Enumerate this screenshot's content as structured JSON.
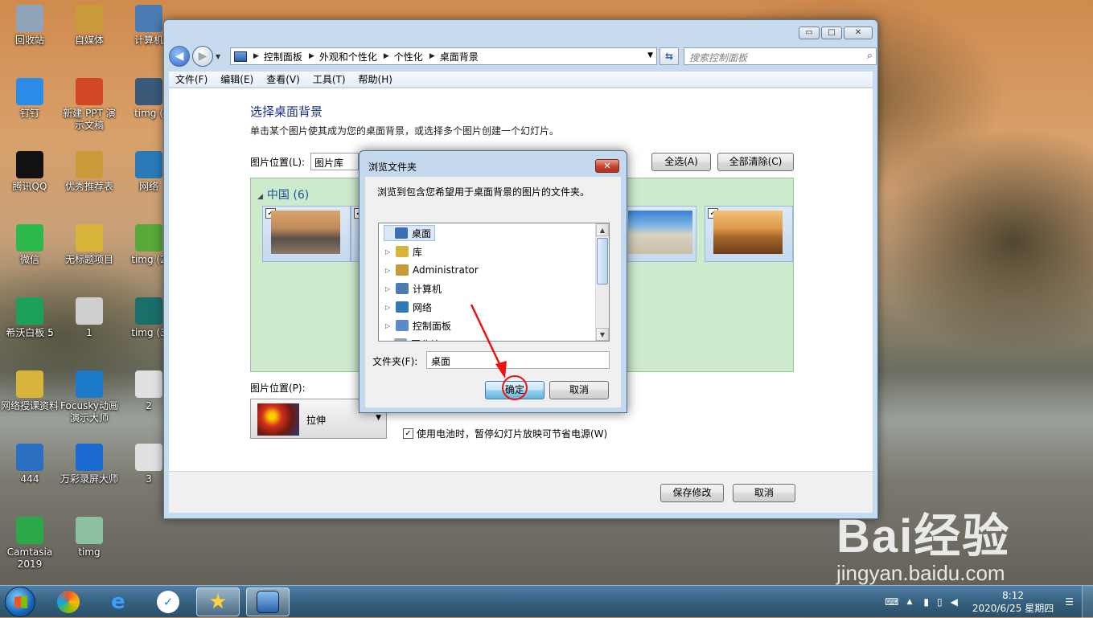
{
  "desktop_icons": [
    {
      "label": "回收站",
      "icon": "recycle-bin-icon",
      "color": "#8fa4b8"
    },
    {
      "label": "自媒体",
      "icon": "folder-icon",
      "color": "#c99a3a"
    },
    {
      "label": "计算机",
      "icon": "computer-icon",
      "color": "#4a7cb3"
    },
    {
      "label": "钉钉",
      "icon": "dingtalk-icon",
      "color": "#2a8ce6"
    },
    {
      "label": "新建 PPT 演示文稿",
      "icon": "ppt-file-icon",
      "color": "#d24726"
    },
    {
      "label": "timg (",
      "icon": "image-file-icon",
      "color": "#3a5a7a"
    },
    {
      "label": "腾讯QQ",
      "icon": "qq-icon",
      "color": "#111111"
    },
    {
      "label": "优秀推荐表",
      "icon": "folder-icon",
      "color": "#c99a3a"
    },
    {
      "label": "网络",
      "icon": "network-icon",
      "color": "#2a7ab8"
    },
    {
      "label": "微信",
      "icon": "wechat-icon",
      "color": "#2db84b"
    },
    {
      "label": "无标题项目",
      "icon": "folder-icon",
      "color": "#d9b43a"
    },
    {
      "label": "timg (2",
      "icon": "image-file-icon",
      "color": "#58a83a"
    },
    {
      "label": "希沃白板 5",
      "icon": "seewo-icon",
      "color": "#1ca05a"
    },
    {
      "label": "1",
      "icon": "image-file-icon",
      "color": "#cfcfcf"
    },
    {
      "label": "timg (3",
      "icon": "image-file-icon",
      "color": "#1a6f6a"
    },
    {
      "label": "网络授课资料",
      "icon": "folder-icon",
      "color": "#d9b43a"
    },
    {
      "label": "Focusky动画演示大师",
      "icon": "focusky-icon",
      "color": "#1b7ac9"
    },
    {
      "label": "2",
      "icon": "image-file-icon",
      "color": "#e0e0e0"
    },
    {
      "label": "444",
      "icon": "fs-file-icon",
      "color": "#2a6fc0"
    },
    {
      "label": "万彩录屏大师",
      "icon": "recorder-icon",
      "color": "#1b6ad0"
    },
    {
      "label": "3",
      "icon": "image-file-icon",
      "color": "#e0e0e0"
    },
    {
      "label": "Camtasia 2019",
      "icon": "camtasia-icon",
      "color": "#2aa84a"
    },
    {
      "label": "timg",
      "icon": "image-file-icon",
      "color": "#8cc0a0"
    }
  ],
  "window": {
    "controls": {
      "minimize": "▭",
      "maximize": "□",
      "close": "✕"
    },
    "breadcrumbs": [
      "控制面板",
      "外观和个性化",
      "个性化",
      "桌面背景"
    ],
    "search_placeholder": "搜索控制面板",
    "menu": [
      "文件(F)",
      "编辑(E)",
      "查看(V)",
      "工具(T)",
      "帮助(H)"
    ],
    "title": "选择桌面背景",
    "description": "单击某个图片使其成为您的桌面背景，或选择多个图片创建一个幻灯片。",
    "location_label": "图片位置(L):",
    "location_value": "图片库",
    "select_all": "全选(A)",
    "clear_all": "全部清除(C)",
    "group_label": "中国 (6)",
    "position_label": "图片位置(P):",
    "position_value": "拉伸",
    "battery_option": "使用电池时，暂停幻灯片放映可节省电源(W)",
    "save_button": "保存修改",
    "cancel_button": "取消"
  },
  "dialog": {
    "title": "浏览文件夹",
    "close": "✕",
    "instruction": "浏览到包含您希望用于桌面背景的图片的文件夹。",
    "tree": [
      {
        "label": "桌面",
        "icon": "desktop-icon",
        "selected": true,
        "expandable": false,
        "color": "#3a6fb0"
      },
      {
        "label": "库",
        "icon": "library-icon",
        "selected": false,
        "expandable": true,
        "color": "#d9b43a"
      },
      {
        "label": "Administrator",
        "icon": "user-folder-icon",
        "selected": false,
        "expandable": true,
        "color": "#c99a3a"
      },
      {
        "label": "计算机",
        "icon": "computer-icon",
        "selected": false,
        "expandable": true,
        "color": "#4a7cb3"
      },
      {
        "label": "网络",
        "icon": "network-icon",
        "selected": false,
        "expandable": true,
        "color": "#2a7ab8"
      },
      {
        "label": "控制面板",
        "icon": "control-panel-icon",
        "selected": false,
        "expandable": true,
        "color": "#5a8ac8"
      },
      {
        "label": "回收站",
        "icon": "recycle-bin-icon",
        "selected": false,
        "expandable": false,
        "color": "#8fa4b8"
      }
    ],
    "folder_label": "文件夹(F):",
    "folder_value": "桌面",
    "ok_button": "确定",
    "cancel_button": "取消"
  },
  "taskbar": {
    "time": "8:12",
    "date": "2020/6/25 星期四"
  },
  "watermark": {
    "main": "Bai经验",
    "sub": "jingyan.baidu.com"
  }
}
